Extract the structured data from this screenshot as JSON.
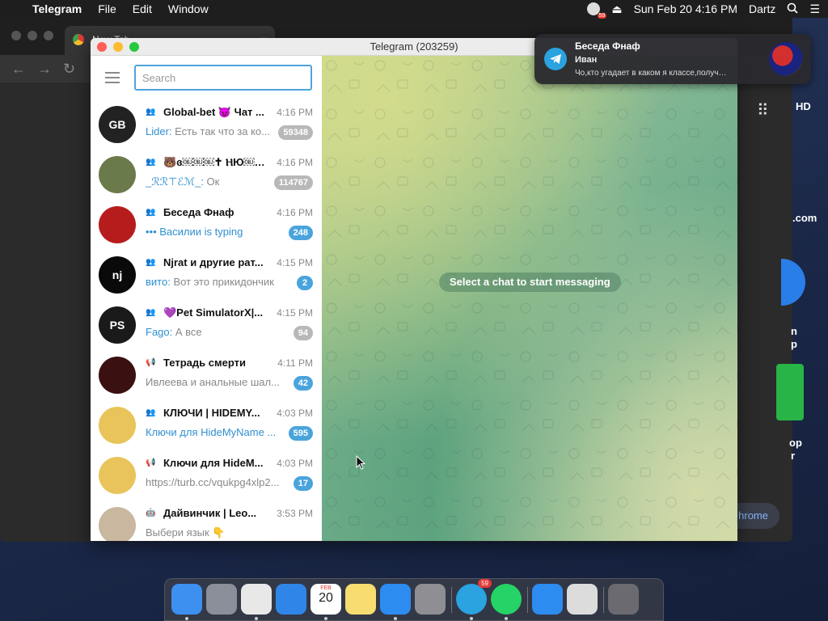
{
  "menubar": {
    "app_name": "Telegram",
    "menus": [
      "File",
      "Edit",
      "Window"
    ],
    "tray_badge": "59",
    "clock": "Sun Feb 20  4:16 PM",
    "user": "Dartz"
  },
  "chrome": {
    "tab_title": "New Tab",
    "side_texts": [
      "HD",
      ".com",
      "n",
      "p",
      "op",
      "r"
    ],
    "pill_label": "hrome"
  },
  "notification": {
    "title": "Беседа Фнаф",
    "sender": "Иван",
    "body": "Чо,кто угадает в каком я классе,получ…"
  },
  "telegram": {
    "window_title": "Telegram (203259)",
    "search_placeholder": "Search",
    "empty_hint": "Select a chat to start messaging",
    "chats": [
      {
        "type_icon": "group-icon",
        "name": "Global-bet 😈 Чат ...",
        "time": "4:16 PM",
        "sender": "Lider",
        "preview": "Есть так что за ко...",
        "badge": "59348",
        "badge_style": "muted",
        "avatar_color": "#222222",
        "avatar_text": "GB"
      },
      {
        "type_icon": "group-icon",
        "name": "🐻ɞ￼￼￼✝ ⲎЮ￼￼...",
        "time": "4:16 PM",
        "sender": "_ℛℛ⊤ℰℳ_",
        "preview": "Ок",
        "badge": "114767",
        "badge_style": "muted",
        "avatar_color": "#6b7a4a",
        "avatar_text": ""
      },
      {
        "type_icon": "group-icon",
        "name": "Беседа Фнаф",
        "time": "4:16 PM",
        "sender": "",
        "preview": "••• Василии is typing",
        "badge": "248",
        "badge_style": "active",
        "avatar_color": "#b71c1c",
        "avatar_text": ""
      },
      {
        "type_icon": "group-icon",
        "name": "Njrat и другие рат...",
        "time": "4:15 PM",
        "sender": "вито",
        "preview": "Вот это прикидончик",
        "badge": "2",
        "badge_style": "active",
        "avatar_color": "#0a0a0a",
        "avatar_text": "nj"
      },
      {
        "type_icon": "group-icon",
        "name": "💜Pet SimulatorX|...",
        "time": "4:15 PM",
        "sender": "Fago",
        "preview": "А все",
        "badge": "94",
        "badge_style": "muted",
        "avatar_color": "#1a1a1a",
        "avatar_text": "PS"
      },
      {
        "type_icon": "megaphone-icon",
        "name": "Тетрадь смерти",
        "time": "4:11 PM",
        "sender": "",
        "preview": "Ивлеева и анальные шал...",
        "badge": "42",
        "badge_style": "active",
        "avatar_color": "#3a1010",
        "avatar_text": ""
      },
      {
        "type_icon": "group-icon",
        "name": "КЛЮЧИ | HIDEMY...",
        "time": "4:03 PM",
        "sender": "",
        "preview": "Ключи для HideMyName ...",
        "badge": "595",
        "badge_style": "active",
        "avatar_color": "#e8c45a",
        "avatar_text": ""
      },
      {
        "type_icon": "megaphone-icon",
        "name": "Ключи для HideM...",
        "time": "4:03 PM",
        "sender": "",
        "preview": "https://turb.cc/vqukpg4xlp2...",
        "badge": "17",
        "badge_style": "active",
        "avatar_color": "#e8c45a",
        "avatar_text": ""
      },
      {
        "type_icon": "bot-icon",
        "name": "Дайвинчик | Leo...",
        "time": "3:53 PM",
        "sender": "",
        "preview": "Выбери язык 👇",
        "badge": "",
        "badge_style": "none",
        "avatar_color": "#c9b7a0",
        "avatar_text": ""
      }
    ]
  },
  "dock": {
    "apps": [
      {
        "name": "finder-icon",
        "color": "#3d8ff0"
      },
      {
        "name": "launchpad-icon",
        "color": "#8a8f99"
      },
      {
        "name": "chrome-icon",
        "color": "#e8e8e8"
      },
      {
        "name": "safari-icon",
        "color": "#2f86e8"
      },
      {
        "name": "calendar-icon",
        "color": "#ffffff"
      },
      {
        "name": "notes-icon",
        "color": "#f7dc6f"
      },
      {
        "name": "app-store-icon",
        "color": "#2d8cf0"
      },
      {
        "name": "system-preferences-icon",
        "color": "#8e8e93"
      },
      {
        "name": "telegram-icon",
        "color": "#2aa3e0"
      },
      {
        "name": "whatsapp-icon",
        "color": "#25d366"
      },
      {
        "name": "app-store-downloads-icon",
        "color": "#2d8cf0"
      },
      {
        "name": "documents-icon",
        "color": "#dcdcdc"
      },
      {
        "name": "trash-icon",
        "color": "#6a6a70"
      }
    ],
    "calendar_month": "FEB",
    "calendar_day": "20",
    "telegram_badge": "59"
  }
}
